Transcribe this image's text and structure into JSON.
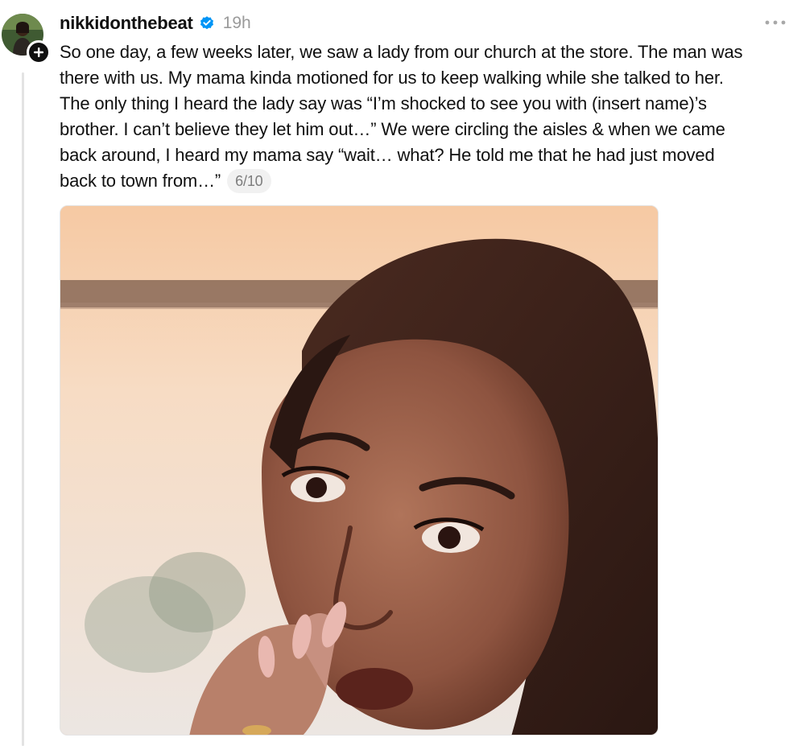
{
  "post": {
    "author": {
      "username": "nikkidonthebeat",
      "verified": true,
      "avatar_icon": "profile-photo"
    },
    "timestamp": "19h",
    "menu_icon": "more-horizontal-icon",
    "text_lines": [
      "So one day, a few weeks later, we saw a lady from our church at the store. The man was",
      "there with us. My mama kinda motioned for us to keep walking while she talked to her.",
      "The only thing I heard the lady say was “I’m shocked to see you with (insert name)’s",
      "brother. I can’t believe they let him out…” We were circling the aisles & when we came",
      "back around, I heard my mama say “wait… what? He told me that he had just moved",
      "back to town from…”"
    ],
    "thread_counter": "6/10",
    "media": {
      "type": "photo"
    }
  },
  "colors": {
    "text": "#101010",
    "muted": "#9a9a9a",
    "verified_blue": "#0095f6",
    "thread_line": "#e3e3e3",
    "counter_bg": "#f1f1f1"
  }
}
